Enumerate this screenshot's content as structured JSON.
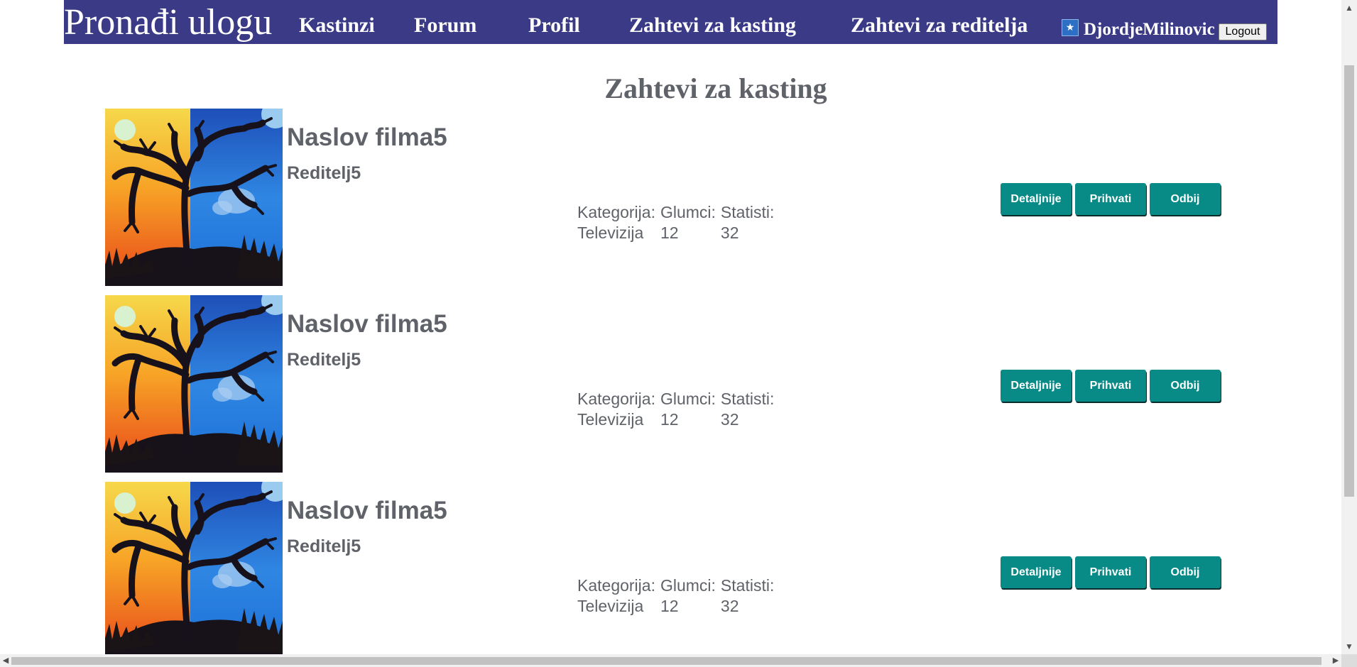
{
  "navbar": {
    "brand": "Pronađi ulogu",
    "items": [
      "Kastinzi",
      "Forum",
      "Profil",
      "Zahtevi za kasting",
      "Zahtevi za reditelja"
    ],
    "username": "DjordjeMilinovic",
    "logout_label": "Logout",
    "background_color": "#3b3a87"
  },
  "page_title": "Zahtevi za kasting",
  "info_labels": {
    "category": "Kategorija:",
    "actors": "Glumci:",
    "extras": "Statisti:"
  },
  "buttons": {
    "details": "Detaljnije",
    "accept": "Prihvati",
    "reject": "Odbij",
    "color": "#088a87"
  },
  "requests": [
    {
      "title": "Naslov filma5",
      "director": "Reditelj5",
      "category": "Televizija",
      "actors": "12",
      "extras": "32"
    },
    {
      "title": "Naslov filma5",
      "director": "Reditelj5",
      "category": "Televizija",
      "actors": "12",
      "extras": "32"
    },
    {
      "title": "Naslov filma5",
      "director": "Reditelj5",
      "category": "Televizija",
      "actors": "12",
      "extras": "32"
    }
  ],
  "icons": {
    "poster": "tree-painting-image",
    "avatar": "user-avatar-icon",
    "scroll_up": "arrow-up-icon",
    "scroll_down": "arrow-down-icon",
    "scroll_left": "arrow-left-icon",
    "scroll_right": "arrow-right-icon"
  }
}
